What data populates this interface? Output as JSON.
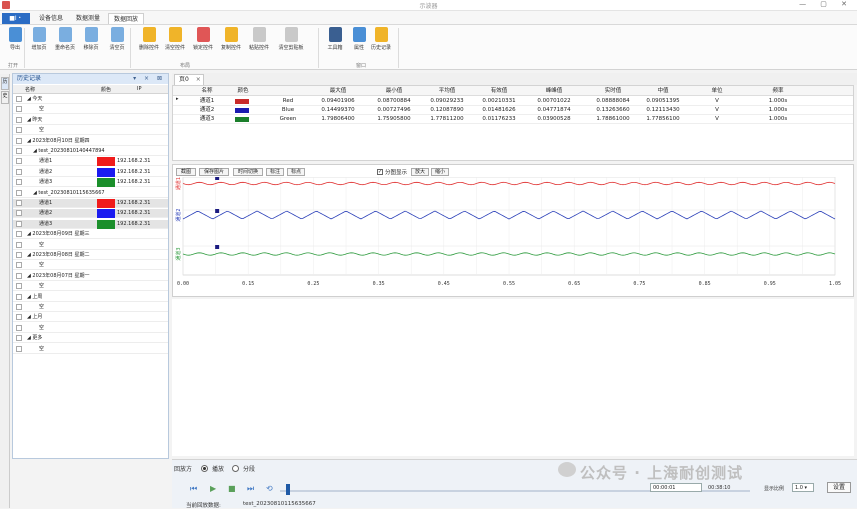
{
  "window": {
    "title": "示波器"
  },
  "menu": {
    "file": "■I・",
    "tabs": [
      "设备信息",
      "数据测量",
      "数据回放"
    ],
    "active": 2
  },
  "ribbon": {
    "buttons": [
      {
        "label": "导出",
        "icon": "export-icon",
        "color": "#4a8fd6"
      },
      {
        "label": "增加页",
        "icon": "add-page-icon",
        "color": "#7aaee0"
      },
      {
        "label": "重命名页",
        "icon": "rename-page-icon",
        "color": "#7aaee0"
      },
      {
        "label": "移除页",
        "icon": "remove-page-icon",
        "color": "#7aaee0"
      },
      {
        "label": "清空页",
        "icon": "clear-page-icon",
        "color": "#7aaee0"
      },
      {
        "label": "删除控件",
        "icon": "delete-control-icon",
        "color": "#f0b429"
      },
      {
        "label": "清空控件",
        "icon": "clear-control-icon",
        "color": "#f0b429"
      },
      {
        "label": "锁定控件",
        "icon": "lock-control-icon",
        "color": "#e05656"
      },
      {
        "label": "复制控件",
        "icon": "copy-control-icon",
        "color": "#f0b429"
      },
      {
        "label": "粘贴控件",
        "icon": "paste-control-icon",
        "color": "#c9c9c9"
      },
      {
        "label": "清空剪贴板",
        "icon": "clear-clipboard-icon",
        "color": "#c9c9c9"
      },
      {
        "label": "工具箱",
        "icon": "toolbox-icon",
        "color": "#3a5f91"
      },
      {
        "label": "属性",
        "icon": "properties-icon",
        "color": "#4a8fd6"
      },
      {
        "label": "历史记录",
        "icon": "history-icon",
        "color": "#f0b429"
      }
    ],
    "groups": [
      "打开",
      "布局",
      "窗口"
    ]
  },
  "lefttabs": [
    "历",
    "史"
  ],
  "history": {
    "title": "历史记录",
    "controls": "▾ × ⊠",
    "columns": [
      "名称",
      "颜色",
      "IP"
    ],
    "rows": [
      {
        "text": "◢ 今天",
        "level": 0
      },
      {
        "text": "空",
        "level": 2
      },
      {
        "text": "◢ 昨天",
        "level": 0
      },
      {
        "text": "空",
        "level": 2
      },
      {
        "text": "◢ 2023年08月10日 星期四",
        "level": 0
      },
      {
        "text": "◢ test_20230810140447894",
        "level": 1
      },
      {
        "text": "通道1",
        "level": 2,
        "color": "#f01b1b",
        "ip": "192.168.2.31"
      },
      {
        "text": "通道2",
        "level": 2,
        "color": "#1b1bf0",
        "ip": "192.168.2.31"
      },
      {
        "text": "通道3",
        "level": 2,
        "color": "#1b8f2b",
        "ip": "192.168.2.31"
      },
      {
        "text": "◢ test_20230810115635667",
        "level": 1
      },
      {
        "text": "通道1",
        "level": 2,
        "color": "#f01b1b",
        "ip": "192.168.2.31",
        "sel": true
      },
      {
        "text": "通道2",
        "level": 2,
        "color": "#1b1bf0",
        "ip": "192.168.2.31",
        "sel": true
      },
      {
        "text": "通道3",
        "level": 2,
        "color": "#1b8f2b",
        "ip": "192.168.2.31",
        "sel": true
      },
      {
        "text": "◢ 2023年08月09日 星期三",
        "level": 0
      },
      {
        "text": "空",
        "level": 2
      },
      {
        "text": "◢ 2023年08月08日 星期二",
        "level": 0
      },
      {
        "text": "空",
        "level": 2
      },
      {
        "text": "◢ 2023年08月07日 星期一",
        "level": 0
      },
      {
        "text": "空",
        "level": 2
      },
      {
        "text": "◢ 上周",
        "level": 0
      },
      {
        "text": "空",
        "level": 2
      },
      {
        "text": "◢ 上月",
        "level": 0
      },
      {
        "text": "空",
        "level": 2
      },
      {
        "text": "◢ 更多",
        "level": 0
      },
      {
        "text": "空",
        "level": 2
      }
    ]
  },
  "doc": {
    "tab": "页0",
    "close": "×"
  },
  "grid": {
    "columns": [
      "名称",
      "颜色",
      "",
      "最大值",
      "最小值",
      "平均值",
      "有效值",
      "峰峰值",
      "实时值",
      "中值",
      "单位",
      "频率"
    ],
    "rows": [
      {
        "name": "通道1",
        "color": "#c92a2a",
        "colorname": "Red",
        "max": "0.09401906",
        "min": "0.08700884",
        "avg": "0.09029233",
        "rms": "0.00210331",
        "pp": "0.00701022",
        "rt": "0.08888084",
        "mid": "0.09051395",
        "unit": "V",
        "freq": "1.000s"
      },
      {
        "name": "通道2",
        "color": "#1b1bb0",
        "colorname": "Blue",
        "max": "0.14499370",
        "min": "0.00727496",
        "avg": "0.12087890",
        "rms": "0.01481626",
        "pp": "0.04771874",
        "rt": "0.13263660",
        "mid": "0.12113430",
        "unit": "V",
        "freq": "1.000s"
      },
      {
        "name": "通道3",
        "color": "#1b7f2b",
        "colorname": "Green",
        "max": "1.79806400",
        "min": "1.75905800",
        "avg": "1.77811200",
        "rms": "0.01176233",
        "pp": "0.03900528",
        "rt": "1.78861000",
        "mid": "1.77856100",
        "unit": "V",
        "freq": "1.000s"
      }
    ]
  },
  "chartbar": {
    "buttons": [
      "截图",
      "保存图片",
      "时间切换",
      "标注",
      "标点"
    ],
    "check": "分图显示",
    "zoomin": "放大",
    "zoomout": "缩小"
  },
  "chart_data": {
    "type": "line",
    "x_ticks": [
      "0.00",
      "0.15",
      "0.25",
      "0.35",
      "0.45",
      "0.55",
      "0.65",
      "0.75",
      "0.85",
      "0.95",
      "1.05"
    ],
    "xlim": [
      0,
      1.05
    ],
    "series": [
      {
        "label": "通道1",
        "color": "#e03030",
        "level": 0.09,
        "amp": 0.002
      },
      {
        "label": "通道2",
        "color": "#2a3fb8",
        "level": 0.12,
        "amp": 0.02
      },
      {
        "label": "通道3",
        "color": "#2e9b3e",
        "level": 1.78,
        "amp": 0.002
      }
    ]
  },
  "playback": {
    "label": "回放方",
    "mode1": "播放",
    "mode2": "分段",
    "time": "00:00:01",
    "end": "00:38:10",
    "speed_label": "显示比例",
    "speed": "1.0",
    "set": "设置",
    "current_label": "当前回放数据:",
    "current": "test_20230810115635667"
  },
  "watermark": "公众号 · 上海耐创测试"
}
